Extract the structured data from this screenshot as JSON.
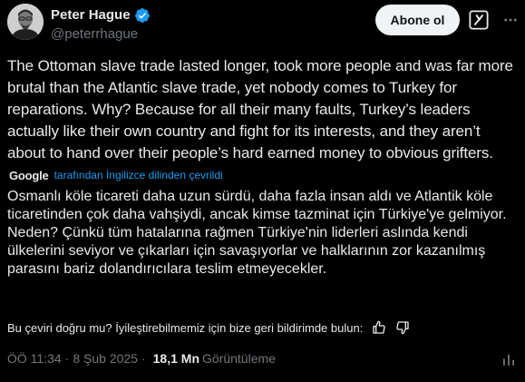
{
  "author": {
    "display_name": "Peter Hague",
    "handle": "@peterrhague",
    "verified_color": "#1d9bf0"
  },
  "actions": {
    "subscribe_label": "Abone ol",
    "grok_icon": "grok-icon",
    "more_icon": "more-icon"
  },
  "tweet": {
    "text": "The Ottoman slave trade lasted longer, took more people and was far more brutal than the Atlantic slave trade, yet nobody comes to Turkey for reparations. Why? Because for all their many faults, Turkey’s leaders actually like their own country and fight for its interests, and they aren’t about to hand over their people’s hard earned money to obvious grifters.",
    "translation_provider": "Google",
    "translation_note": "tarafından İngilizce dilinden çevrildi",
    "translated_text": "Osmanlı köle ticareti daha uzun sürdü, daha fazla insan aldı ve Atlantik köle ticaretinden çok daha vahşiydi, ancak kimse tazminat için Türkiye'ye gelmiyor. Neden? Çünkü tüm hatalarına rağmen Türkiye'nin liderleri aslında kendi ülkelerini seviyor ve çıkarları için savaşıyorlar ve halklarının zor kazanılmış parasını bariz dolandırıcılara teslim etmeyecekler."
  },
  "feedback": {
    "prompt": "Bu çeviri doğru mu? İyileştirebilmemiz için bize geri bildirimde bulun:",
    "thumbs_up_icon": "thumbs-up-icon",
    "thumbs_down_icon": "thumbs-down-icon"
  },
  "meta": {
    "time": "ÖÖ 11:34",
    "separator1": "·",
    "date": "8 Şub 2025",
    "separator2": "·",
    "views_count": "18,1 Mn",
    "views_label": "Görüntüleme",
    "analytics_icon": "analytics-icon"
  },
  "colors": {
    "background": "#000000",
    "text": "#e7e9ea",
    "secondary": "#71767b",
    "link": "#1d9bf0",
    "button_bg": "#eff3f4"
  }
}
